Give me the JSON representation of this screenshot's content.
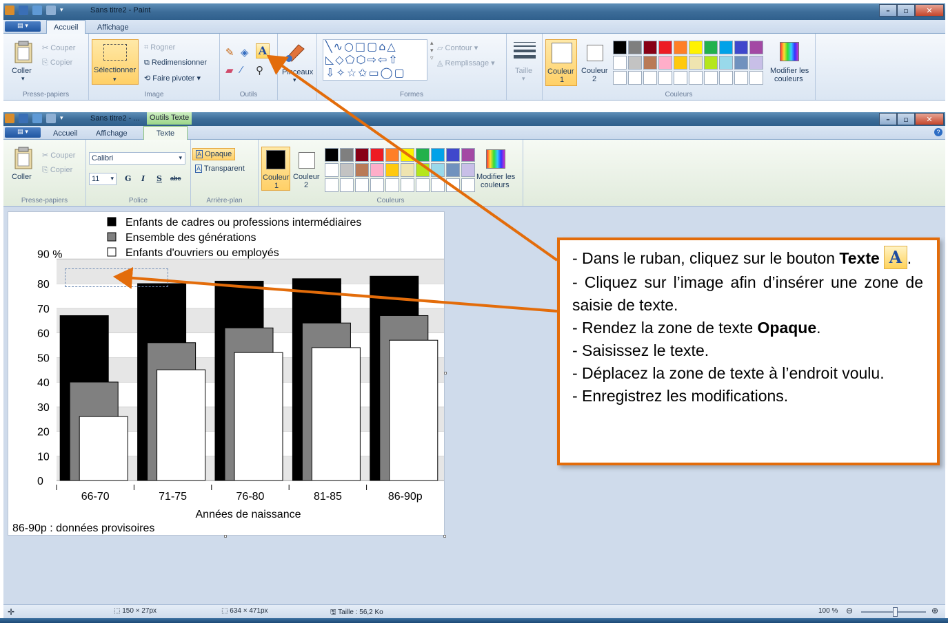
{
  "top_window": {
    "title": "Sans titre2 - Paint",
    "tabs": [
      "Accueil",
      "Affichage"
    ],
    "clipboard": {
      "paste": "Coller",
      "cut": "Couper",
      "copy": "Copier",
      "label": "Presse-papiers"
    },
    "image": {
      "select": "Sélectionner",
      "crop": "Rogner",
      "resize": "Redimensionner",
      "rotate": "Faire pivoter",
      "label": "Image"
    },
    "tools": {
      "label": "Outils"
    },
    "brushes": {
      "label": "Pinceaux"
    },
    "shapes": {
      "outline": "Contour",
      "fill": "Remplissage",
      "label": "Formes"
    },
    "size": {
      "label": "Taille"
    },
    "colors": {
      "color1": "Couleur",
      "color1_num": "1",
      "color2": "Couleur",
      "color2_num": "2",
      "edit": "Modifier les",
      "edit2": "couleurs",
      "label": "Couleurs"
    }
  },
  "text_window": {
    "title": "Sans titre2 - ...",
    "context_tab": "Outils Texte",
    "tabs": [
      "Accueil",
      "Affichage",
      "Texte"
    ],
    "clipboard": {
      "paste": "Coller",
      "cut": "Couper",
      "copy": "Copier",
      "label": "Presse-papiers"
    },
    "font": {
      "family": "Calibri",
      "size": "11",
      "bold": "G",
      "italic": "I",
      "underline": "S",
      "strike": "abc",
      "label": "Police"
    },
    "background": {
      "opaque": "Opaque",
      "transparent": "Transparent",
      "label": "Arrière-plan"
    },
    "colors": {
      "color1": "Couleur",
      "color1_num": "1",
      "color2": "Couleur",
      "color2_num": "2",
      "edit": "Modifier les",
      "edit2": "couleurs",
      "label": "Couleurs"
    }
  },
  "palette": [
    "#000000",
    "#7f7f7f",
    "#880015",
    "#ed1c24",
    "#ff7f27",
    "#fff200",
    "#22b14c",
    "#00a2e8",
    "#3f48cc",
    "#a349a4",
    "#ffffff",
    "#c3c3c3",
    "#b97a57",
    "#ffaec9",
    "#ffc90e",
    "#efe4b0",
    "#b5e61d",
    "#99d9ea",
    "#7092be",
    "#c8bfe7"
  ],
  "accent": "#e36c0a",
  "chart_data": {
    "type": "bar",
    "categories": [
      "66-70",
      "71-75",
      "76-80",
      "81-85",
      "86-90p"
    ],
    "series": [
      {
        "name": "Enfants de cadres ou professions intermédiaires",
        "color": "#000000",
        "values": [
          67,
          80,
          81,
          82,
          83
        ]
      },
      {
        "name": "Ensemble des générations",
        "color": "#808080",
        "values": [
          40,
          56,
          62,
          64,
          67
        ]
      },
      {
        "name": "Enfants d'ouvriers ou employés",
        "color": "#ffffff",
        "values": [
          26,
          45,
          52,
          54,
          57
        ]
      }
    ],
    "ylim": [
      0,
      90
    ],
    "yticks": [
      "90 %",
      "80",
      "70",
      "60",
      "50",
      "40",
      "30",
      "20",
      "10",
      "0"
    ],
    "xlabel": "Années de naissance",
    "note": "86-90p : données provisoires",
    "grid": "alternating bands",
    "legend": "top"
  },
  "callout": {
    "line1": "- Dans le ruban, cliquez sur le bouton",
    "texte": "Texte",
    "line2": "- Cliquez sur l’image afin d’insérer une zone de saisie de texte.",
    "line3a": "- Rendez la zone de texte ",
    "opaque": "Opaque",
    "line4": "- Saisissez le texte.",
    "line5": "- Déplacez la zone de texte à l’endroit voulu.",
    "line6": "- Enregistrez les modifications.",
    "a_letter": "A"
  },
  "status": {
    "selection": "150 × 27px",
    "canvas": "634 × 471px",
    "size": "Taille : 56,2 Ko",
    "zoom": "100 %",
    "zoom_level": 1.0
  }
}
